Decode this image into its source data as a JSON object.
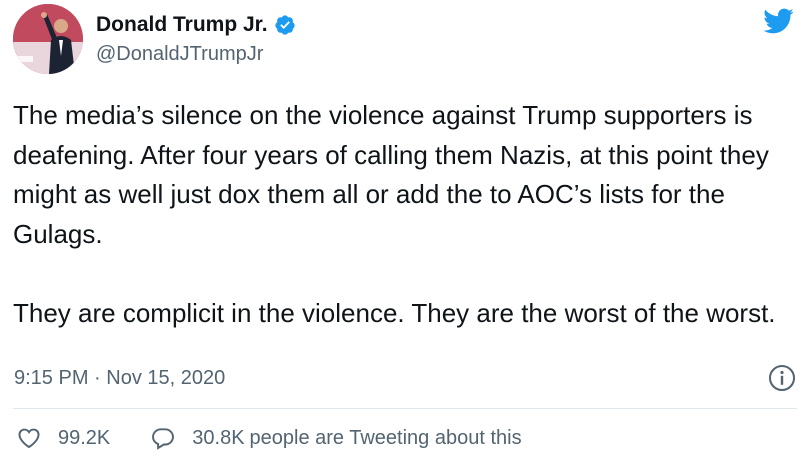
{
  "author": {
    "display_name": "Donald Trump Jr.",
    "handle": "@DonaldJTrumpJr",
    "verified_icon": "verified-badge-icon",
    "avatar": "profile-photo"
  },
  "brand": {
    "logo_icon": "twitter-bird-icon",
    "color": "#1d9bf0"
  },
  "tweet": {
    "paragraphs": [
      "The media’s silence on the violence against Trump supporters is deafening. After four years of calling them Nazis, at this point they might as well just dox them all or add the to AOC’s lists for the Gulags.",
      "They are complicit in the violence. They are the worst of the worst."
    ],
    "timestamp": "9:15 PM · Nov 15, 2020",
    "info_icon": "info-icon"
  },
  "stats": {
    "likes": "99.2K",
    "like_icon": "heart-icon",
    "replies": "30.8K",
    "reply_suffix": "people are Tweeting about this",
    "reply_icon": "speech-bubble-icon"
  },
  "colors": {
    "text": "#0f1419",
    "secondary": "#536471",
    "divider": "#e1e8ed",
    "verified": "#1d9bf0"
  }
}
